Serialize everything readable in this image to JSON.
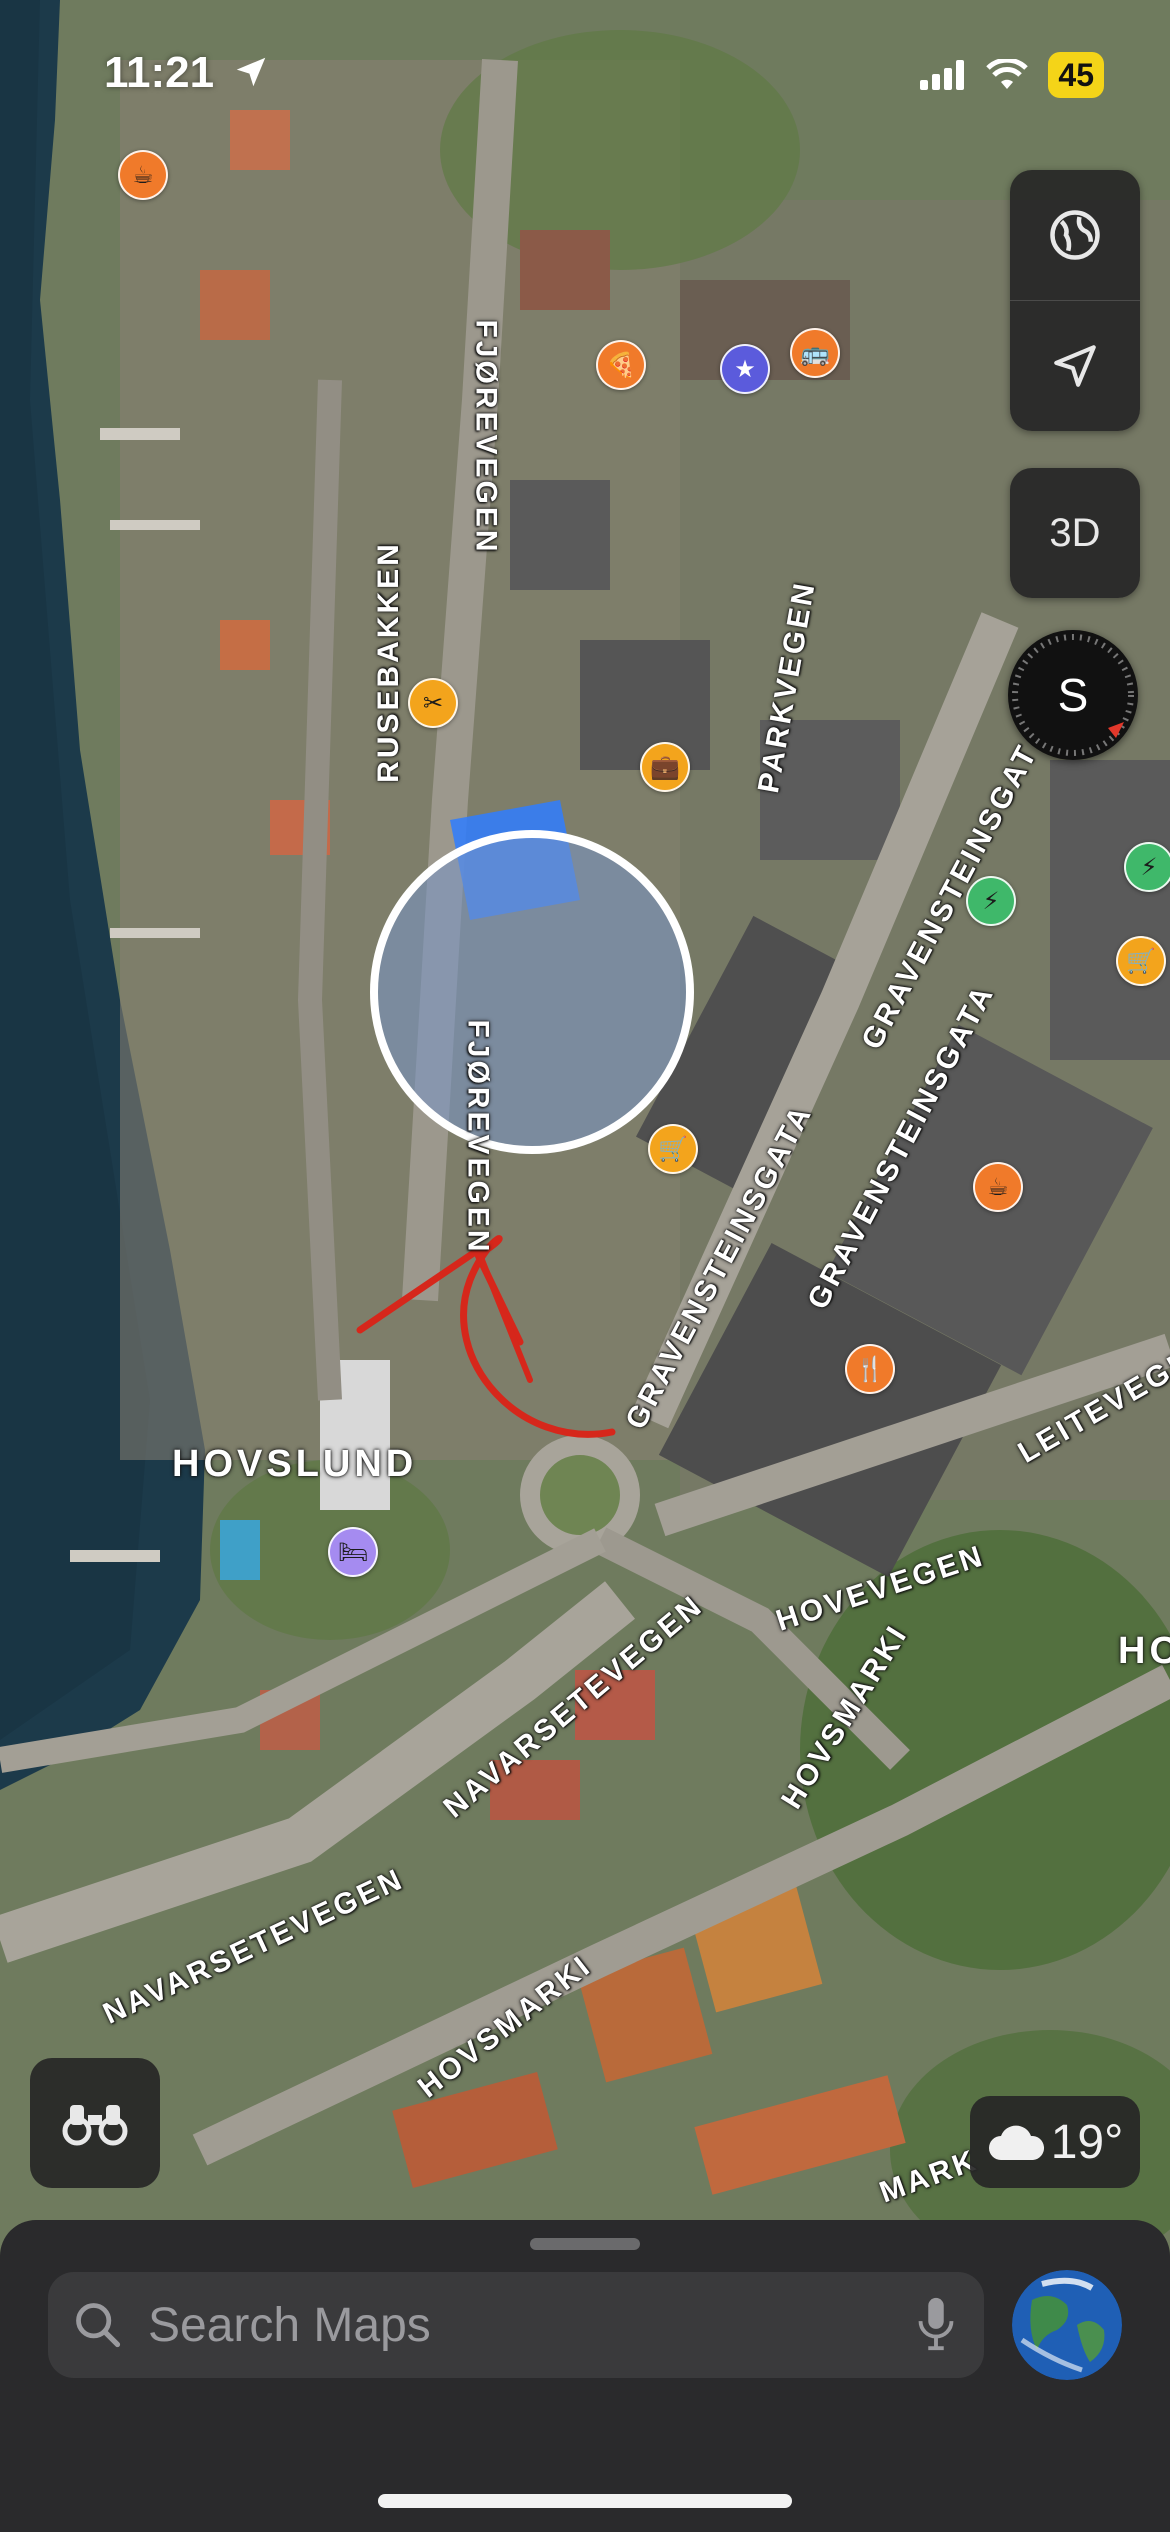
{
  "status_bar": {
    "time": "11:21",
    "battery": "45"
  },
  "map": {
    "street_labels": [
      "FJØREVEGEN",
      "RUSEBAKKEN",
      "PARKVEGEN",
      "GRAVENSTEINSGAT",
      "GRAVENSTEINSGATA",
      "FJØREVEGEN",
      "GRAVENSTEINSGATA",
      "LEITEVEGE",
      "HOVEVEGEN",
      "NAVARSETEVEGEN",
      "HOVSMARKI",
      "NAVARSETEVEGEN",
      "HOVSMARKI",
      "MARK"
    ],
    "place_labels": [
      "HOVSLUND",
      "HO"
    ]
  },
  "controls": {
    "view_3d_label": "3D",
    "compass_heading": "S"
  },
  "weather": {
    "temperature": "19°"
  },
  "search": {
    "placeholder": "Search Maps"
  }
}
